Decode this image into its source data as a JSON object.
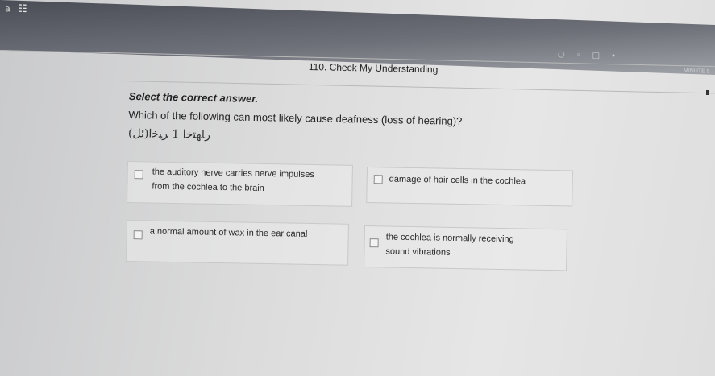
{
  "topbar": {
    "left_text": "a",
    "grid_icon": "grid-icon",
    "icons": [
      "circle-icon",
      "bell-icon",
      "window-icon"
    ],
    "right_text": "MINUTE 5"
  },
  "heading": "110. Check My Understanding",
  "instruction": "Select the correct answer.",
  "question": "Which of the following can most likely cause deafness (loss of hearing)?",
  "handwriting": "(ئل)ﺭﺎﻬﺘﺧﺍ 1 ﺮﺒﺧﺍ",
  "options": [
    {
      "text": "the auditory nerve carries nerve impulses from the cochlea to the brain",
      "checked": false
    },
    {
      "text": "damage of hair cells in the cochlea",
      "checked": false
    },
    {
      "text": "a normal amount of wax in the ear canal",
      "checked": false
    },
    {
      "text": "the cochlea is normally receiving sound vibrations",
      "checked": false
    }
  ]
}
